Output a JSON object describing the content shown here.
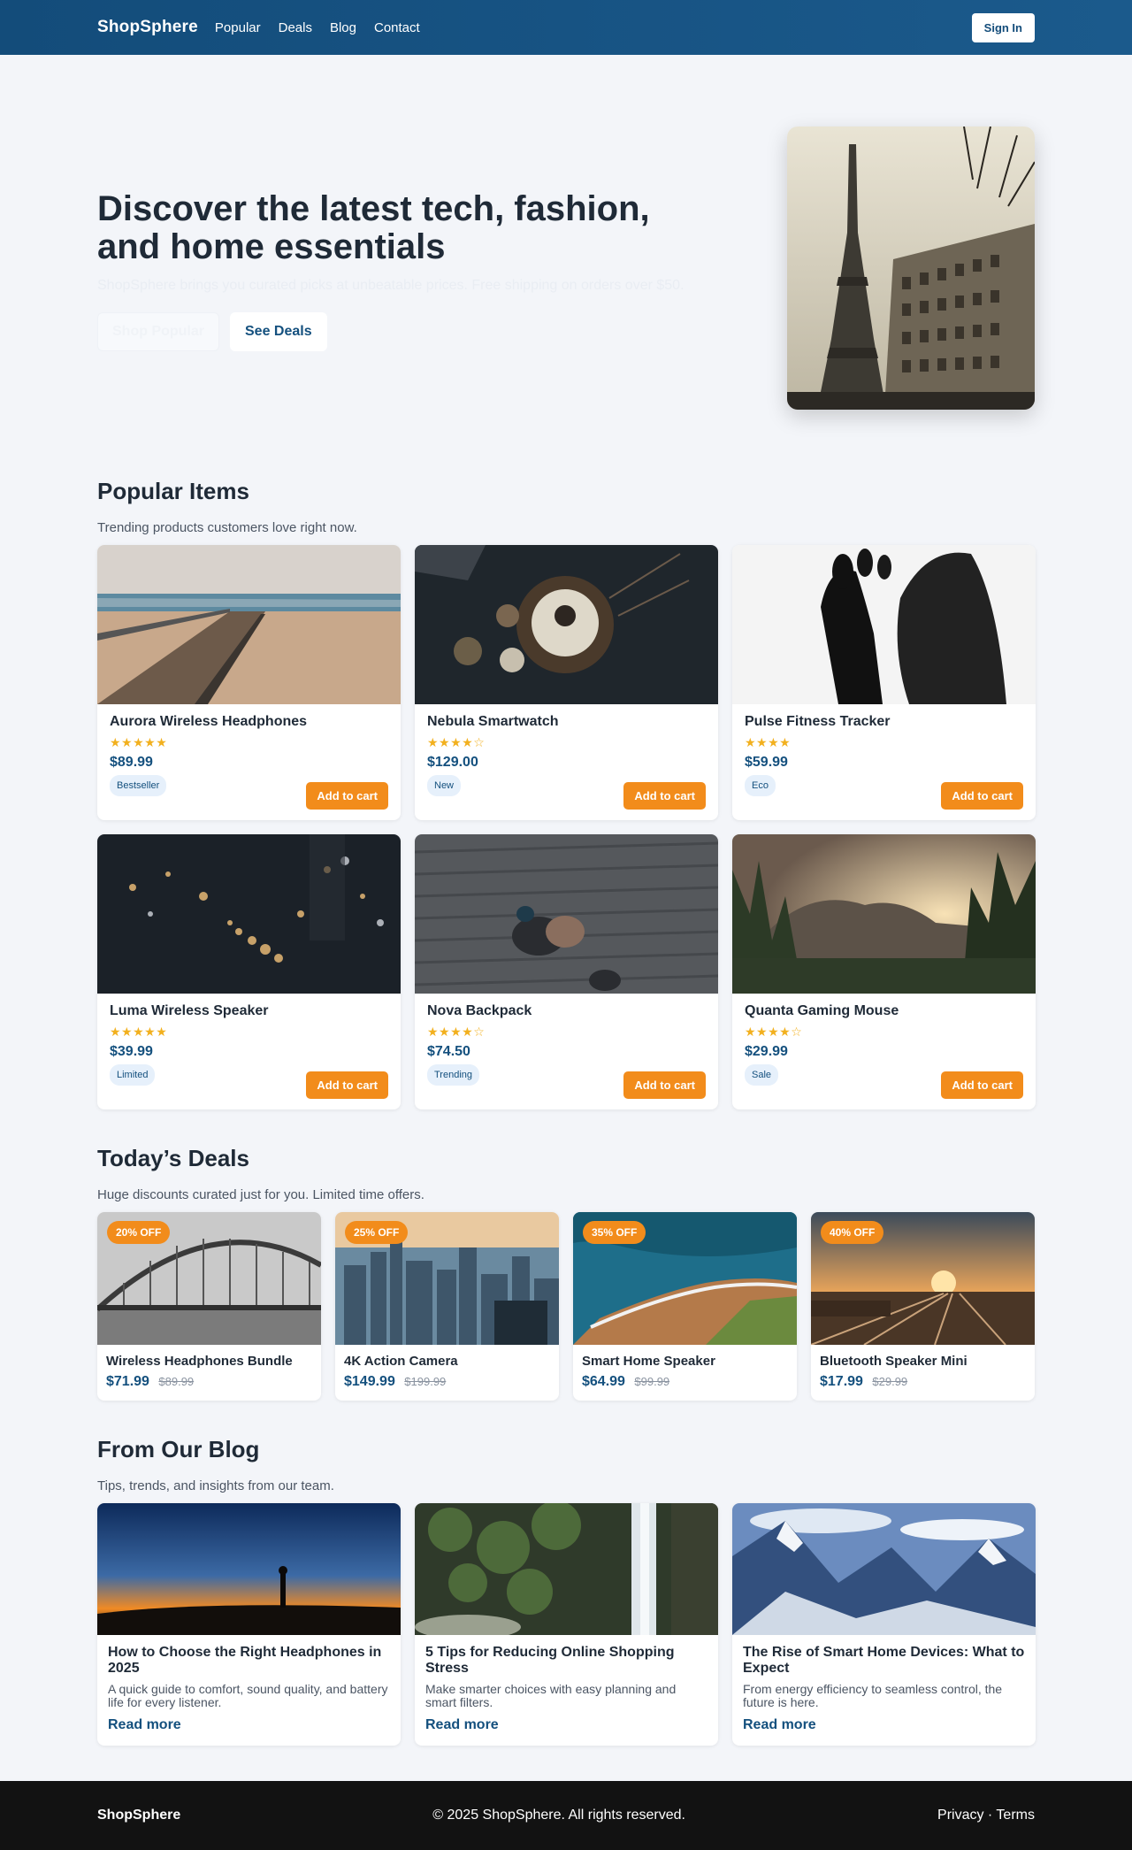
{
  "nav": {
    "brand": "ShopSphere",
    "links": [
      "Popular",
      "Deals",
      "Blog",
      "Contact"
    ],
    "signin": "Sign In"
  },
  "hero": {
    "title": "Discover the latest tech, fashion, and home essentials",
    "subtitle": "ShopSphere brings you curated picks at unbeatable prices. Free shipping on orders over $50.",
    "cta_primary": "Shop Popular",
    "cta_secondary": "See Deals"
  },
  "popular": {
    "title": "Popular Items",
    "subtitle": "Trending products customers love right now.",
    "add_label": "Add to cart",
    "items": [
      {
        "name": "Aurora Wireless Headphones",
        "stars": "★★★★★",
        "rating": 5,
        "price": "$89.99",
        "badge": "Bestseller"
      },
      {
        "name": "Nebula Smartwatch",
        "stars": "★★★★☆",
        "rating": 4,
        "price": "$129.00",
        "badge": "New"
      },
      {
        "name": "Pulse Fitness Tracker",
        "stars": "★★★★",
        "rating": 4,
        "price": "$59.99",
        "badge": "Eco"
      },
      {
        "name": "Luma Wireless Speaker",
        "stars": "★★★★★",
        "rating": 5,
        "price": "$39.99",
        "badge": "Limited"
      },
      {
        "name": "Nova Backpack",
        "stars": "★★★★☆",
        "rating": 4,
        "price": "$74.50",
        "badge": "Trending"
      },
      {
        "name": "Quanta Gaming Mouse",
        "stars": "★★★★☆",
        "rating": 4,
        "price": "$29.99",
        "badge": "Sale"
      }
    ]
  },
  "deals": {
    "title": "Today’s Deals",
    "subtitle": "Huge discounts curated just for you. Limited time offers.",
    "items": [
      {
        "off": "20% OFF",
        "name": "Wireless Headphones Bundle",
        "price": "$71.99",
        "was": "$89.99"
      },
      {
        "off": "25% OFF",
        "name": "4K Action Camera",
        "price": "$149.99",
        "was": "$199.99"
      },
      {
        "off": "35% OFF",
        "name": "Smart Home Speaker",
        "price": "$64.99",
        "was": "$99.99"
      },
      {
        "off": "40% OFF",
        "name": "Bluetooth Speaker Mini",
        "price": "$17.99",
        "was": "$29.99"
      }
    ]
  },
  "blog": {
    "title": "From Our Blog",
    "subtitle": "Tips, trends, and insights from our team.",
    "more_label": "Read more",
    "posts": [
      {
        "title": "How to Choose the Right Headphones in 2025",
        "excerpt": "A quick guide to comfort, sound quality, and battery life for every listener."
      },
      {
        "title": "5 Tips for Reducing Online Shopping Stress",
        "excerpt": "Make smarter choices with easy planning and smart filters."
      },
      {
        "title": "The Rise of Smart Home Devices: What to Expect",
        "excerpt": "From energy efficiency to seamless control, the future is here."
      }
    ]
  },
  "footer": {
    "brand": "ShopSphere",
    "copyright": "© 2025 ShopSphere. All rights reserved.",
    "privacy": "Privacy",
    "sep": " · ",
    "terms": "Terms"
  }
}
